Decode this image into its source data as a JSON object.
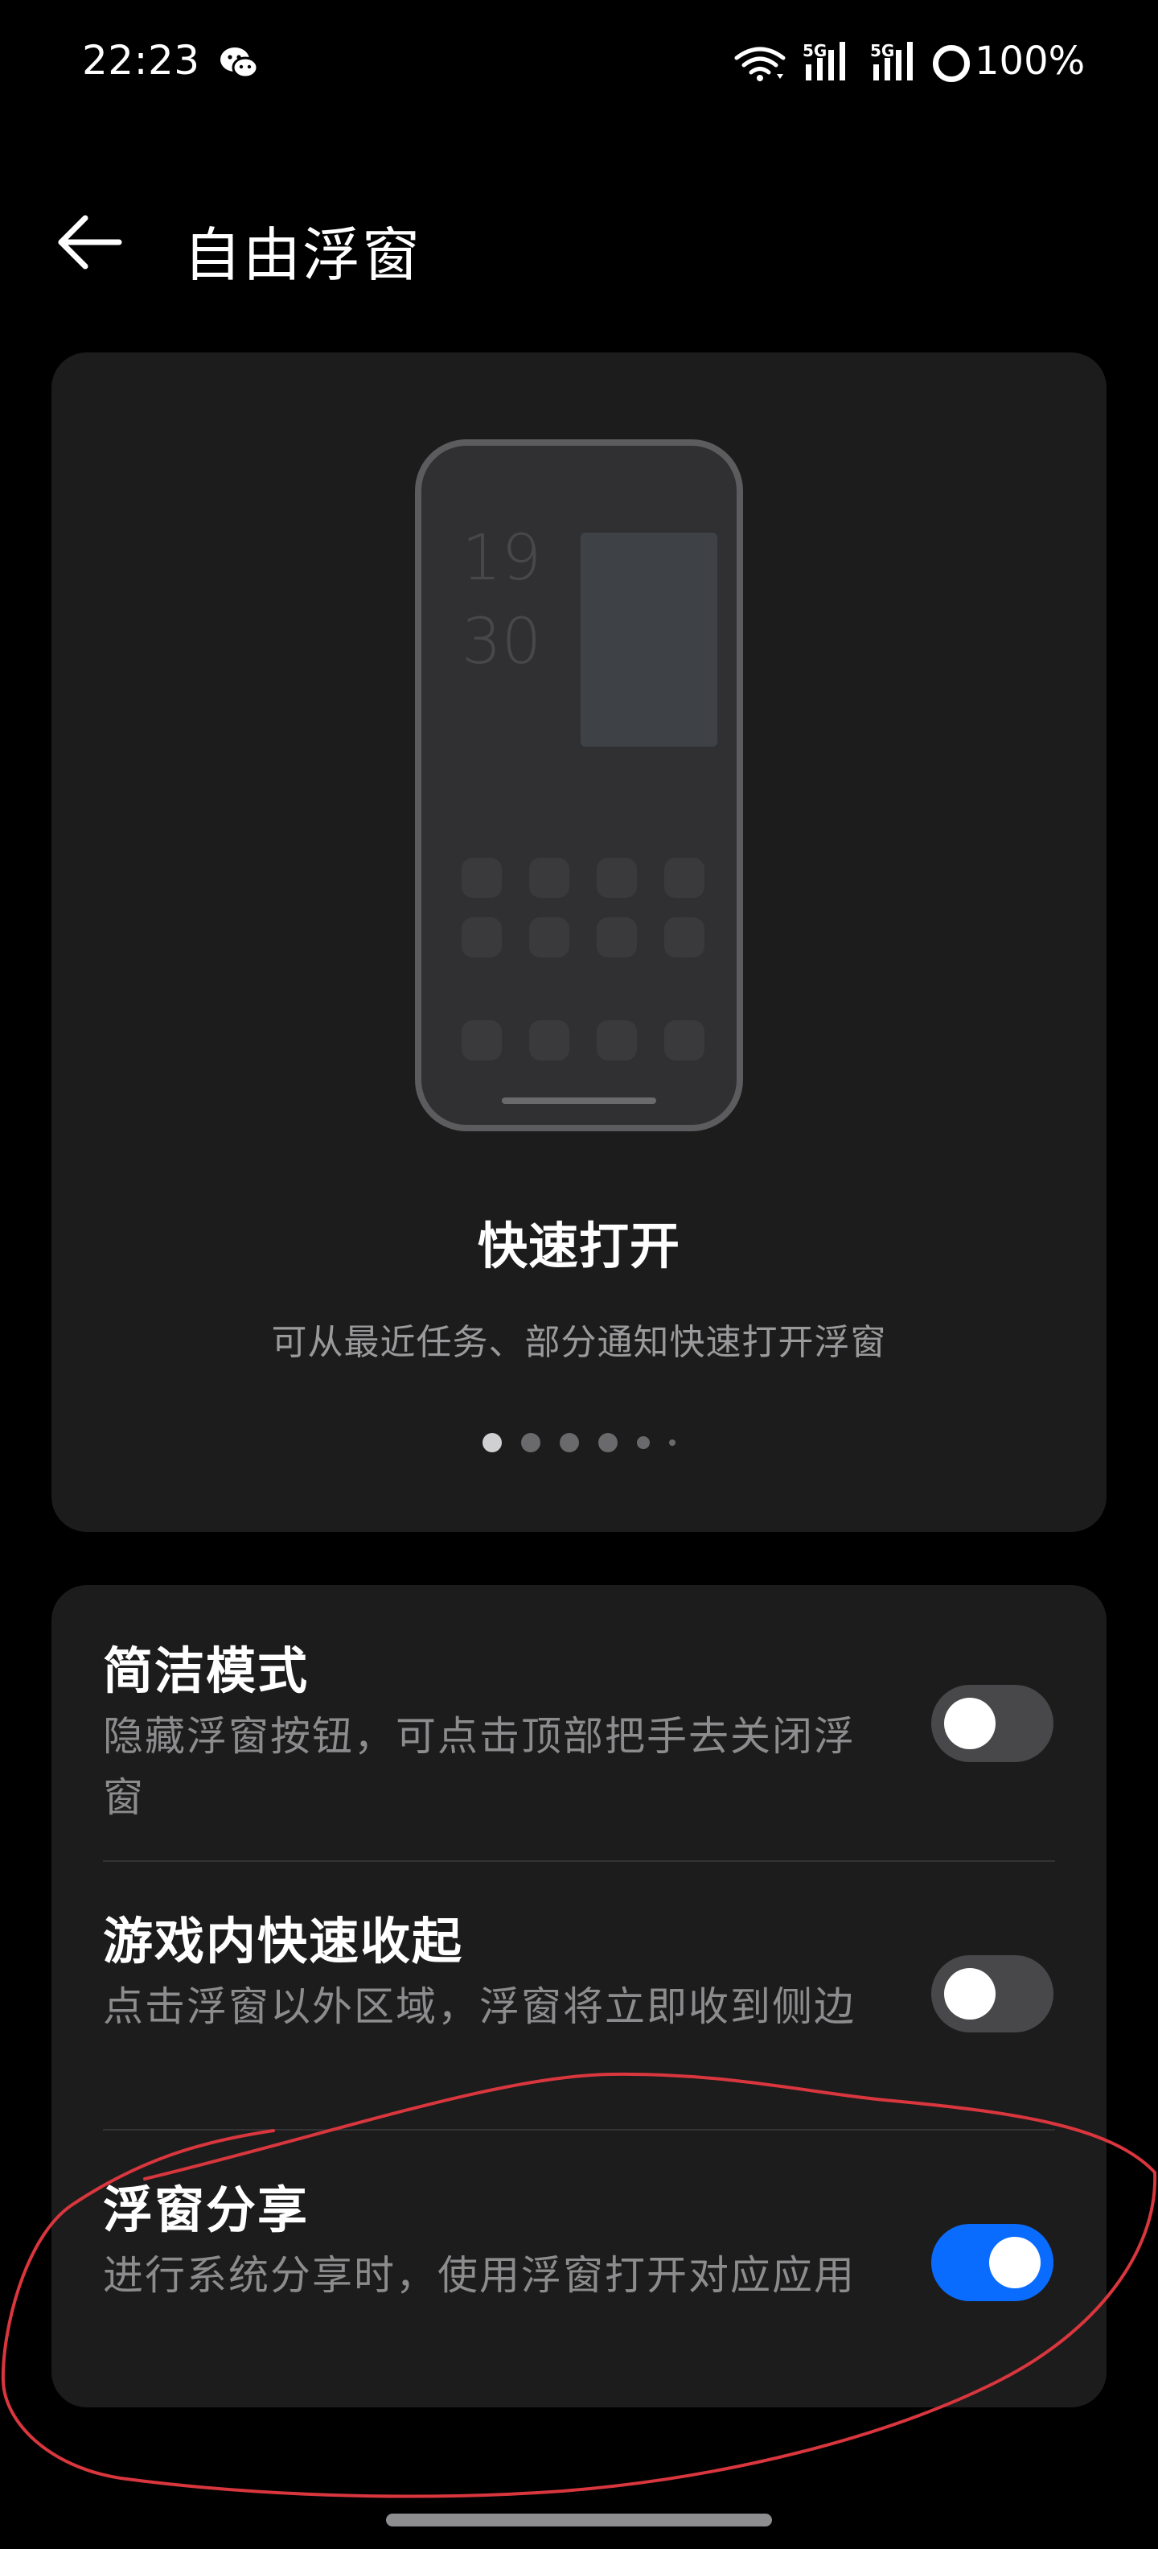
{
  "status_bar": {
    "time": "22:23",
    "battery": "100%",
    "icons": [
      "wechat-icon",
      "wifi-icon",
      "5g-signal-icon",
      "5g-signal-icon",
      "battery-ring-icon"
    ]
  },
  "header": {
    "title": "自由浮窗",
    "back_icon": "arrow-left-icon"
  },
  "preview": {
    "clock_hour": "19",
    "clock_minute": "30",
    "feature_title": "快速打开",
    "feature_desc": "可从最近任务、部分通知快速打开浮窗",
    "pager": {
      "count": 6,
      "active_index": 0
    }
  },
  "settings": [
    {
      "title": "简洁模式",
      "desc": "隐藏浮窗按钮，可点击顶部把手去关闭浮窗",
      "enabled": false
    },
    {
      "title": "游戏内快速收起",
      "desc": "点击浮窗以外区域，浮窗将立即收到侧边",
      "enabled": false
    },
    {
      "title": "浮窗分享",
      "desc": "进行系统分享时，使用浮窗打开对应应用",
      "enabled": true
    }
  ],
  "colors": {
    "background": "#000000",
    "card": "#1c1c1c",
    "accent": "#0a6cff",
    "annotation": "#d9363e"
  }
}
